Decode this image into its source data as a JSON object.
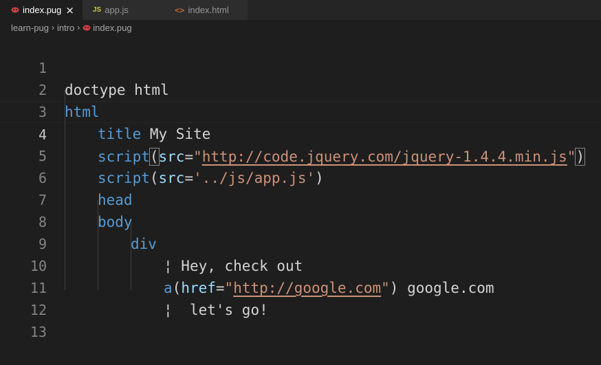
{
  "tabs": [
    {
      "label": "index.pug",
      "icon": "pug-icon",
      "active": true,
      "close": "×"
    },
    {
      "label": "app.js",
      "icon": "js-icon",
      "icon_text": "JS",
      "active": false
    },
    {
      "label": "index.html",
      "icon": "html-icon",
      "icon_text": "<>",
      "active": false
    }
  ],
  "breadcrumb": {
    "parts": [
      "learn-pug",
      "intro",
      "index.pug"
    ],
    "separator": "›"
  },
  "lines": {
    "numbers": [
      "1",
      "2",
      "3",
      "4",
      "5",
      "6",
      "7",
      "8",
      "9",
      "10",
      "11",
      "12",
      "13"
    ],
    "l1": {
      "text": "doctype html"
    },
    "l2": {
      "tag": "html"
    },
    "l3": {
      "tag": "title",
      "text": " My Site"
    },
    "l4": {
      "tag": "script",
      "open": "(",
      "attr": "src",
      "eq": "=",
      "q1": "\"",
      "url": "http://code.jquery.com/jquery-1.4.4.min.js",
      "q2": "\"",
      "close": ")"
    },
    "l5": {
      "tag": "script",
      "open": "(",
      "attr": "src",
      "eq": "=",
      "str": "'../js/app.js'",
      "close": ")"
    },
    "l6": {
      "tag": "head"
    },
    "l7": {
      "tag": "body"
    },
    "l8": {
      "tag": "div"
    },
    "l9": {
      "pipe": "¦",
      "text": " Hey, check out"
    },
    "l10": {
      "tag": "a",
      "open": "(",
      "attr": "href",
      "eq": "=",
      "q1": "\"",
      "url": "http://google.com",
      "q2": "\"",
      "close": ")",
      "text": " google.com"
    },
    "l11": {
      "pipe": "¦",
      "text": "  let's go!"
    }
  },
  "colors": {
    "background": "#1e1e1e",
    "keyword": "#569cd6",
    "attribute": "#9cdcfe",
    "string": "#ce9178",
    "text": "#d4d4d4"
  }
}
